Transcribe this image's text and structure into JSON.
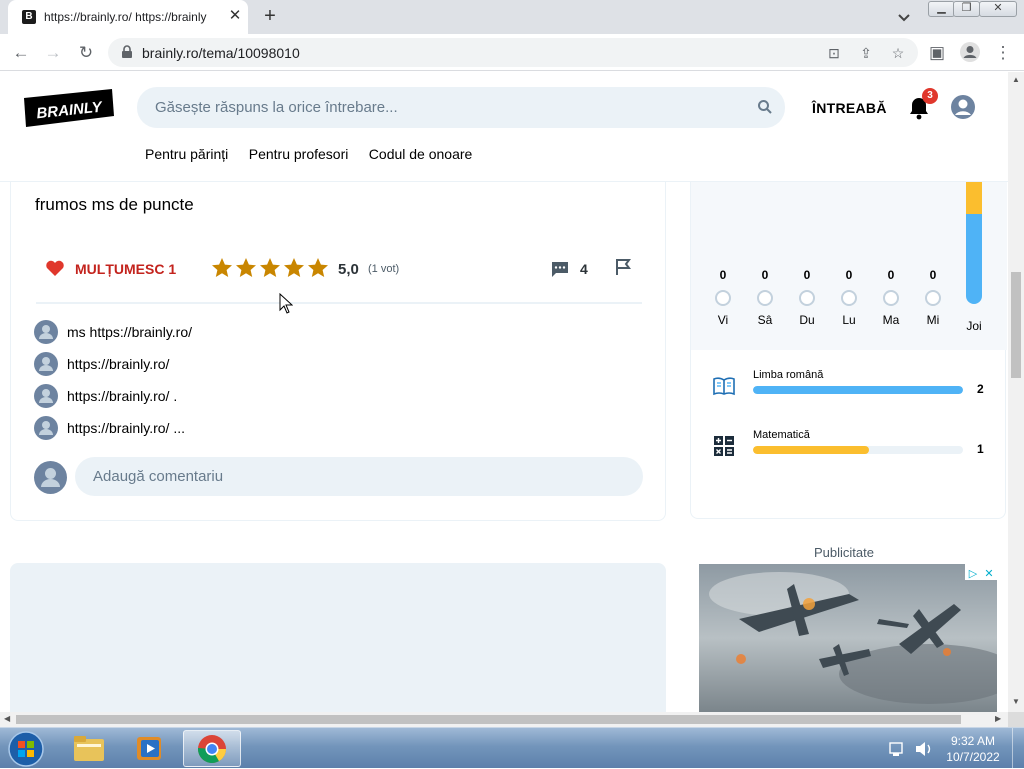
{
  "browser": {
    "tab_favicon": "B",
    "tab_title": "https://brainly.ro/ https://brainly",
    "tab_close": "✕",
    "new_tab": "+",
    "url": "brainly.ro/tema/10098010",
    "window_controls": [
      "minimize",
      "restore",
      "close"
    ]
  },
  "header": {
    "logo_text": "BRAINLY",
    "search_placeholder": "Găsește răspuns la orice întrebare...",
    "ask_label": "ÎNTREABĂ",
    "notification_count": "3",
    "nav": [
      "Pentru părinți",
      "Pentru profesori",
      "Codul de onoare"
    ]
  },
  "answer": {
    "text": "frumos ms de puncte",
    "thanks_label": "MULȚUMESC 1",
    "rating_stars": 5,
    "rating_value": "5,0",
    "votes": "(1 vot)",
    "comments_count": "4",
    "comments": [
      "ms https://brainly.ro/",
      "https://brainly.ro/",
      "https://brainly.ro/ .",
      "https://brainly.ro/ ..."
    ],
    "add_comment_placeholder": "Adaugă comentariu"
  },
  "stats": {
    "days": [
      {
        "count": "0",
        "label": "Vi"
      },
      {
        "count": "0",
        "label": "Sâ"
      },
      {
        "count": "0",
        "label": "Du"
      },
      {
        "count": "0",
        "label": "Lu"
      },
      {
        "count": "0",
        "label": "Ma"
      },
      {
        "count": "0",
        "label": "Mi"
      }
    ],
    "today_label": "Joi",
    "subjects": [
      {
        "name": "Limba română",
        "count": "2",
        "fraction": 1.0,
        "color": "#4fb3f6",
        "icon": "book-icon"
      },
      {
        "name": "Matematică",
        "count": "1",
        "fraction": 0.55,
        "color": "#fbbe2e",
        "icon": "math-icon"
      }
    ]
  },
  "ad": {
    "label": "Publicitate"
  },
  "taskbar": {
    "time": "9:32 AM",
    "date": "10/7/2022"
  },
  "colors": {
    "brand_red": "#c3231d",
    "star_gold": "#c98600",
    "light_blue": "#ebf2f7",
    "accent_blue": "#4fb3f6",
    "accent_yellow": "#fbbe2e"
  }
}
